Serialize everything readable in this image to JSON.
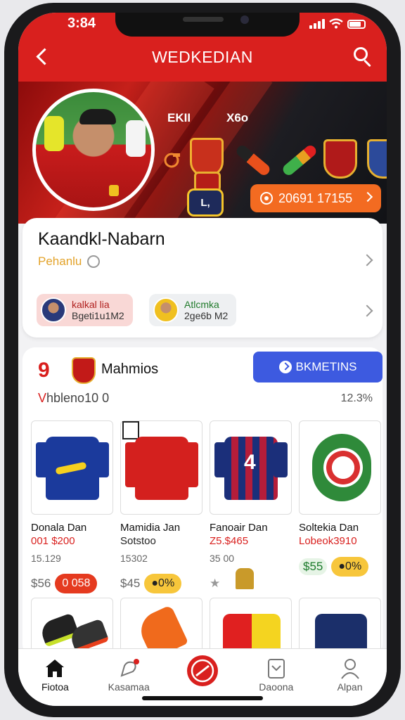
{
  "status": {
    "time": "3:84"
  },
  "header": {
    "title": "WEDKEDIAN"
  },
  "hero": {
    "caption_left": "EKII",
    "caption_right": "X6o",
    "badge_text": "L,",
    "promo_label": "20691 17155"
  },
  "profile": {
    "name": "Kaandkl-Nabarn",
    "subtitle": "Pehanlu",
    "friends": [
      {
        "line1": "kalkal lia",
        "line2": "Bgeti1u1M2",
        "bg": "#f9d8d6"
      },
      {
        "line1": "Atlcmka",
        "line2": "2ge6b M2",
        "bg": "#eef0f2"
      }
    ]
  },
  "market": {
    "count": "9",
    "title": "Mahmios",
    "button_label": "BKMETINS",
    "subtitle_first": "V",
    "subtitle_rest": "hbleno10 0",
    "right_value": "12.3%",
    "products": [
      {
        "name": "Donala Dan",
        "price": "001 $200",
        "sold": "15.129",
        "small": "$56",
        "pill": "0 058",
        "pill_style": "red"
      },
      {
        "name": "Mamidia Jan",
        "price": "Sotstoo",
        "sold": "15302",
        "small": "$45",
        "pill": "0%",
        "pill_style": "yellow"
      },
      {
        "name": "Fanoair Dan",
        "price": "Z5.$465",
        "sold": "35 00",
        "small": "★",
        "pill": "",
        "pill_style": "none"
      },
      {
        "name": "Soltekia Dan",
        "price": "Lobeok3910",
        "sold": "",
        "small": "$55",
        "pill": "0%",
        "pill_style": "yellow"
      }
    ]
  },
  "tabs": [
    {
      "label": "Fiotoa"
    },
    {
      "label": "Kasamaa"
    },
    {
      "label": ""
    },
    {
      "label": "Daoona"
    },
    {
      "label": "Alpan"
    }
  ],
  "colors": {
    "brand_red": "#d9201e",
    "promo_orange": "#f36b21",
    "button_blue": "#3d5ae0"
  }
}
